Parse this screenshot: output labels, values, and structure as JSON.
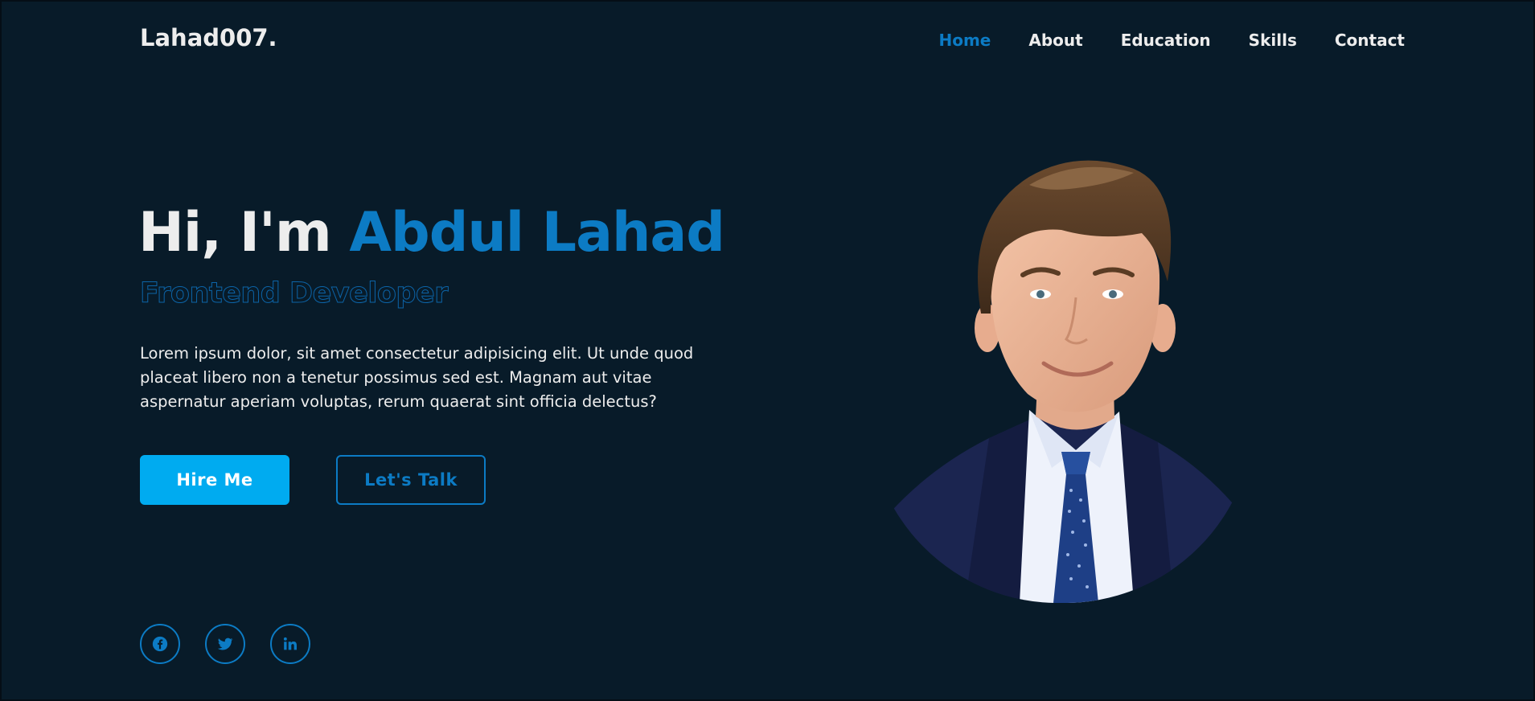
{
  "header": {
    "logo": "Lahad007.",
    "nav": [
      {
        "label": "Home",
        "active": true
      },
      {
        "label": "About",
        "active": false
      },
      {
        "label": "Education",
        "active": false
      },
      {
        "label": "Skills",
        "active": false
      },
      {
        "label": "Contact",
        "active": false
      }
    ]
  },
  "hero": {
    "greeting_prefix": "Hi, I'm",
    "name": "Abdul Lahad",
    "role": "Frontend Developer",
    "description": "Lorem ipsum dolor, sit amet consectetur adipisicing elit. Ut unde quod placeat libero non a tenetur possimus sed est. Magnam aut vitae aspernatur aperiam voluptas, rerum quaerat sint officia delectus?",
    "buttons": {
      "primary": "Hire Me",
      "secondary": "Let's Talk"
    }
  },
  "social": [
    {
      "icon": "facebook-icon"
    },
    {
      "icon": "twitter-icon"
    },
    {
      "icon": "linkedin-icon"
    }
  ],
  "colors": {
    "background": "#081b29",
    "accent": "#0c7bc4",
    "button_primary": "#00abf0",
    "text": "#ededed"
  }
}
